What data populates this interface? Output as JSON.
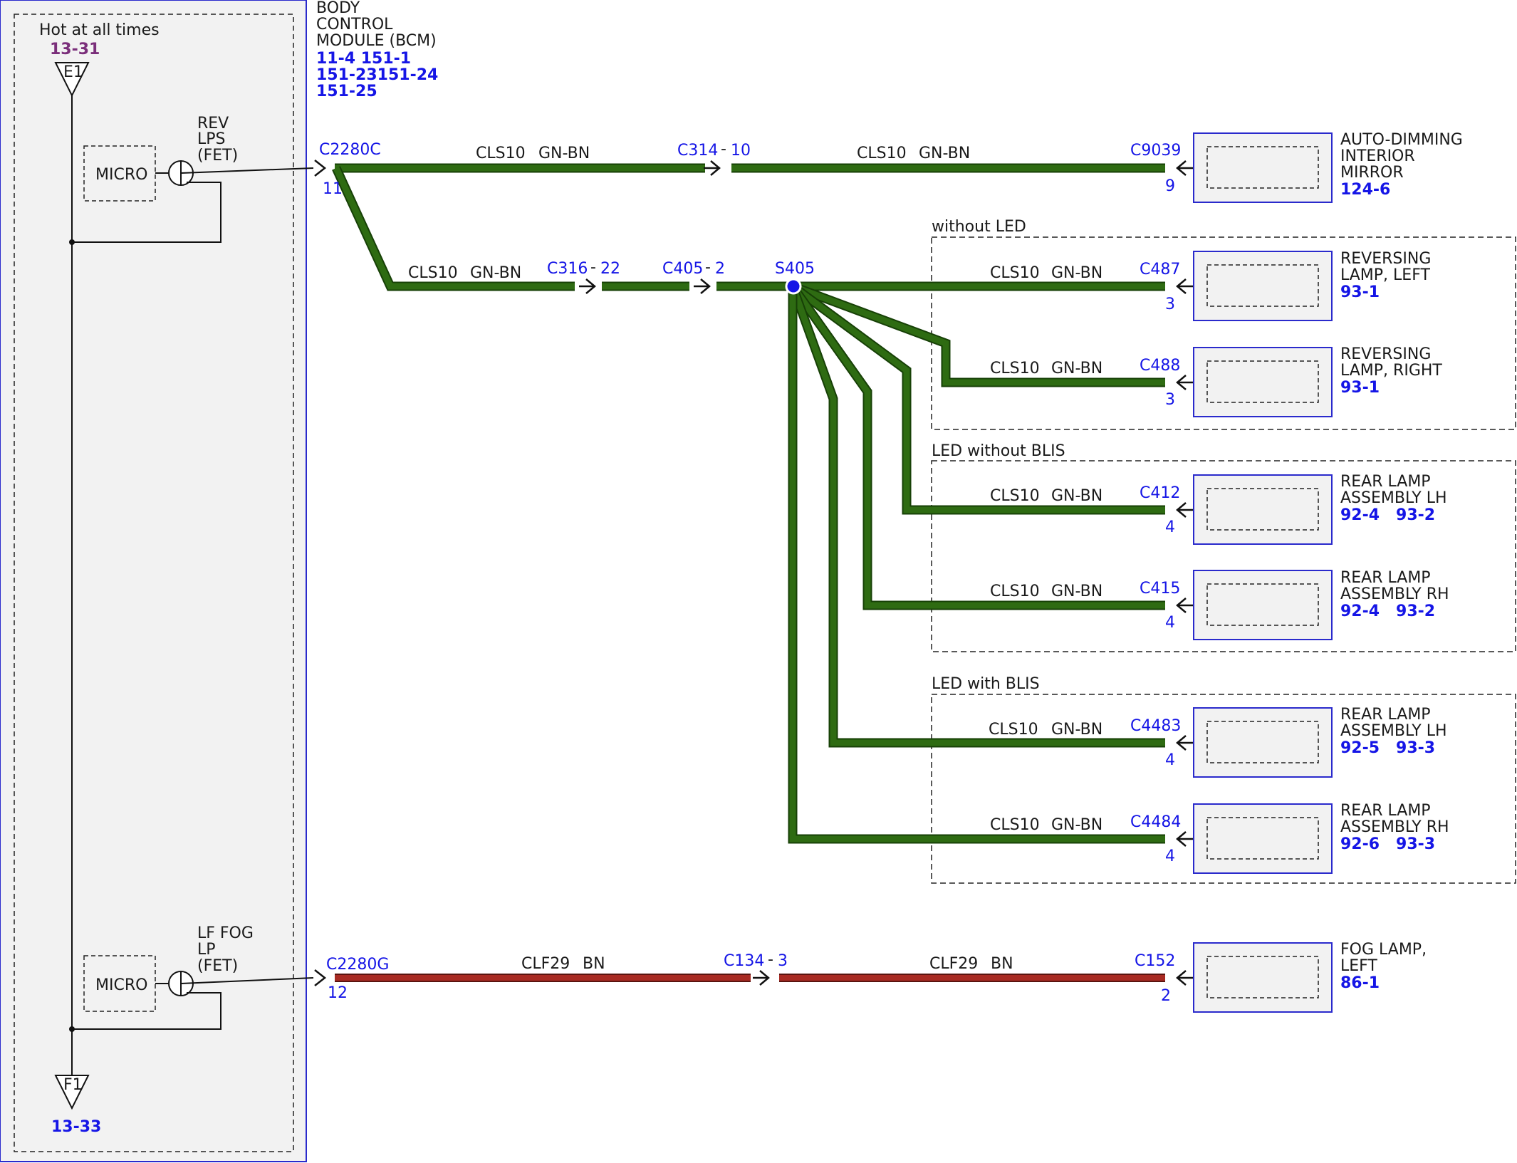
{
  "module": {
    "title_lines": [
      "BODY",
      "CONTROL",
      "MODULE (BCM)"
    ],
    "ref_lines": [
      "11-4  151-1",
      "151-23151-24",
      "151-25"
    ],
    "hot_label": "Hot at all times",
    "hot_ref": "13-31",
    "e1": "E1",
    "f1": "F1",
    "f1_ref": "13-33",
    "micro1": "MICRO",
    "micro2": "MICRO",
    "rev_lines": [
      "REV",
      "LPS",
      "(FET)"
    ],
    "fog_lines": [
      "LF FOG",
      "LP",
      "(FET)"
    ]
  },
  "connectors": {
    "c2280c": "C2280C",
    "c2280c_pin": "11",
    "c314": "C314",
    "c314_pin": "10",
    "c9039": "C9039",
    "c9039_pin": "9",
    "c316": "C316",
    "c316_pin": "22",
    "c405": "C405",
    "c405_pin": "2",
    "s405": "S405",
    "c487": "C487",
    "c487_pin": "3",
    "c488": "C488",
    "c488_pin": "3",
    "c412": "C412",
    "c412_pin": "4",
    "c415": "C415",
    "c415_pin": "4",
    "c4483": "C4483",
    "c4483_pin": "4",
    "c4484": "C4484",
    "c4484_pin": "4",
    "c2280g": "C2280G",
    "c2280g_pin": "12",
    "c134": "C134",
    "c134_pin": "3",
    "c152": "C152",
    "c152_pin": "2",
    "dash": "-"
  },
  "wires": {
    "green_circuit": "CLS10",
    "green_color": "GN-BN",
    "red_circuit": "CLF29",
    "red_color": "BN"
  },
  "groups": {
    "without_led": "without LED",
    "led_without_blis": "LED without BLIS",
    "led_with_blis": "LED with BLIS"
  },
  "components": {
    "mirror": [
      "AUTO-DIMMING",
      "INTERIOR",
      "MIRROR"
    ],
    "mirror_ref": "124-6",
    "rev_left": [
      "REVERSING",
      "LAMP, LEFT"
    ],
    "rev_left_ref": "93-1",
    "rev_right": [
      "REVERSING",
      "LAMP, RIGHT"
    ],
    "rev_right_ref": "93-1",
    "rear_lh1": [
      "REAR LAMP",
      "ASSEMBLY LH"
    ],
    "rear_lh1_ref": "92-4   93-2",
    "rear_rh1": [
      "REAR LAMP",
      "ASSEMBLY RH"
    ],
    "rear_rh1_ref": "92-4   93-2",
    "rear_lh2": [
      "REAR LAMP",
      "ASSEMBLY LH"
    ],
    "rear_lh2_ref": "92-5   93-3",
    "rear_rh2": [
      "REAR LAMP",
      "ASSEMBLY RH"
    ],
    "rear_rh2_ref": "92-6   93-3",
    "fog": [
      "FOG LAMP,",
      "LEFT"
    ],
    "fog_ref": "86-1"
  },
  "colors": {
    "green_wire": "#2e6b12",
    "green_outline": "#174007",
    "red_wire": "#a82a22",
    "red_outline": "#5a1410",
    "blue": "#1515e6",
    "purple": "#7b2f7b",
    "panel": "#f2f2f2"
  }
}
